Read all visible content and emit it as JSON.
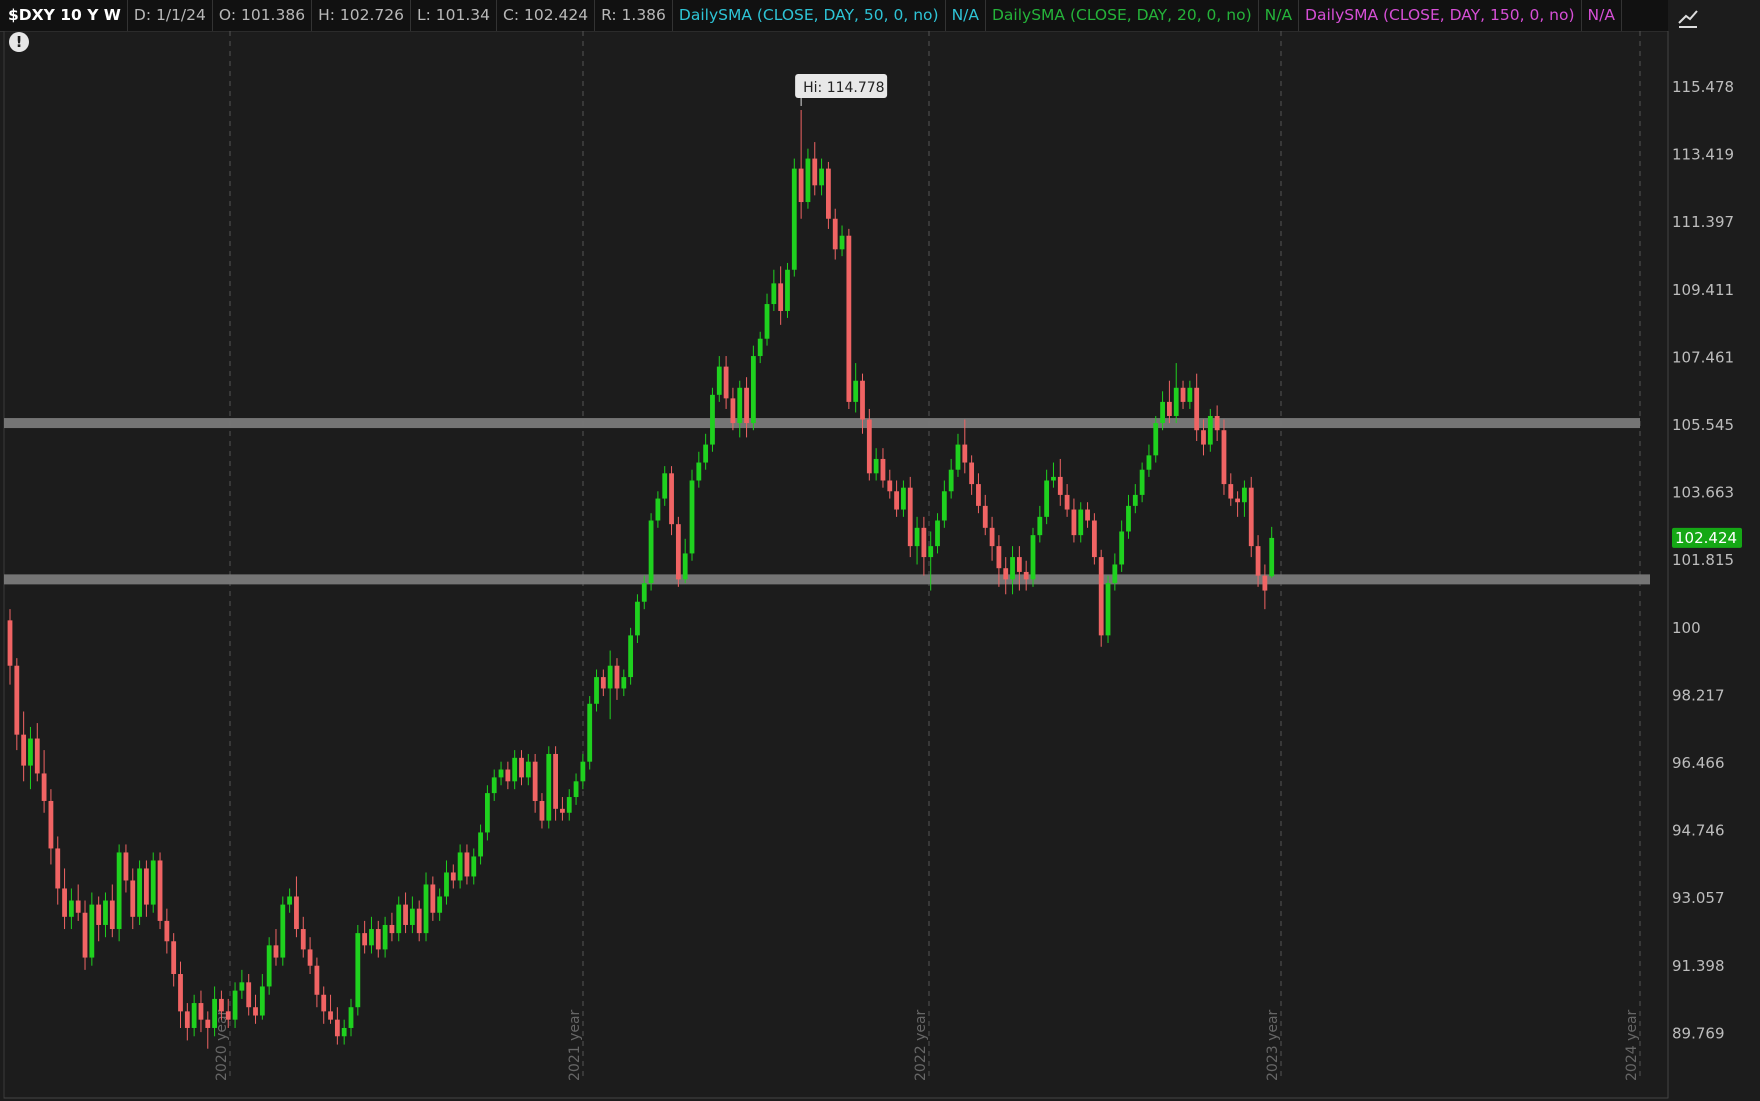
{
  "header": {
    "symbol": "$DXY 10 Y W",
    "date": "D: 1/1/24",
    "open": "O: 101.386",
    "high": "H: 102.726",
    "low": "L: 101.34",
    "close": "C: 102.424",
    "range": "R: 1.386",
    "studies": [
      {
        "label": "DailySMA (CLOSE, DAY, 50, 0, no)",
        "value": "N/A",
        "color": "#2ec4d6"
      },
      {
        "label": "DailySMA (CLOSE, DAY, 20, 0, no)",
        "value": "N/A",
        "color": "#25b33a"
      },
      {
        "label": "DailySMA (CLOSE, DAY, 150, 0, no)",
        "value": "N/A",
        "color": "#d64fd6"
      }
    ]
  },
  "colors": {
    "up": "#1fd11f",
    "down": "#f06464",
    "background": "#1c1c1c",
    "grid": "#555555",
    "level": "#7a7a7a",
    "last_price": "#15a815"
  },
  "icons": {
    "alert": "!",
    "drawing": "drawing-tools-icon"
  },
  "chart_data": {
    "type": "candlestick",
    "y_ticks": [
      "115.478",
      "113.419",
      "111.397",
      "109.411",
      "107.461",
      "105.545",
      "103.663",
      "101.815",
      "100",
      "98.217",
      "96.466",
      "94.746",
      "93.057",
      "91.398",
      "89.769"
    ],
    "x_labels": [
      "2020 year",
      "2021 year",
      "2022 year",
      "2023 year",
      "2024 year"
    ],
    "high_label": "Hi: 114.778",
    "high_value": 114.778,
    "last_price": "102.424",
    "last_value": 102.424,
    "levels": [
      105.6,
      101.3
    ],
    "bars": [
      [
        0,
        100.2,
        99.0,
        100.5,
        98.5
      ],
      [
        1,
        99.0,
        97.2,
        99.2,
        96.8
      ],
      [
        2,
        97.2,
        96.4,
        97.8,
        96.0
      ],
      [
        3,
        96.4,
        97.1,
        97.4,
        95.8
      ],
      [
        4,
        97.1,
        96.2,
        97.5,
        96.0
      ],
      [
        5,
        96.2,
        95.5,
        96.8,
        95.2
      ],
      [
        6,
        95.5,
        94.3,
        95.8,
        93.9
      ],
      [
        7,
        94.3,
        93.3,
        94.6,
        92.9
      ],
      [
        8,
        93.3,
        92.6,
        93.8,
        92.3
      ],
      [
        9,
        92.6,
        93.0,
        93.3,
        92.3
      ],
      [
        10,
        93.0,
        92.7,
        93.4,
        92.5
      ],
      [
        11,
        92.7,
        91.6,
        93.0,
        91.3
      ],
      [
        12,
        91.6,
        92.9,
        93.2,
        91.4
      ],
      [
        13,
        92.9,
        92.4,
        93.1,
        92.0
      ],
      [
        14,
        92.4,
        93.0,
        93.2,
        92.1
      ],
      [
        15,
        93.0,
        92.3,
        93.4,
        92.1
      ],
      [
        16,
        92.3,
        94.2,
        94.4,
        92.0
      ],
      [
        17,
        94.2,
        93.5,
        94.4,
        93.2
      ],
      [
        18,
        93.5,
        92.6,
        93.8,
        92.3
      ],
      [
        19,
        92.6,
        93.8,
        94.0,
        92.4
      ],
      [
        20,
        93.8,
        92.9,
        94.0,
        92.6
      ],
      [
        21,
        92.9,
        94.0,
        94.2,
        92.7
      ],
      [
        22,
        94.0,
        92.5,
        94.2,
        92.3
      ],
      [
        23,
        92.5,
        92.0,
        92.8,
        91.7
      ],
      [
        24,
        92.0,
        91.2,
        92.2,
        90.9
      ],
      [
        25,
        91.2,
        90.3,
        91.5,
        89.9
      ],
      [
        26,
        90.3,
        89.9,
        90.5,
        89.6
      ],
      [
        27,
        89.9,
        90.5,
        90.7,
        89.7
      ],
      [
        28,
        90.5,
        90.1,
        90.8,
        89.8
      ],
      [
        29,
        90.1,
        89.9,
        90.3,
        89.4
      ],
      [
        30,
        89.9,
        90.6,
        90.9,
        89.7
      ],
      [
        31,
        90.6,
        90.3,
        90.8,
        90.1
      ],
      [
        32,
        90.3,
        90.1,
        90.6,
        89.9
      ],
      [
        33,
        90.1,
        90.8,
        91.0,
        89.9
      ],
      [
        34,
        90.8,
        91.0,
        91.3,
        90.6
      ],
      [
        35,
        91.0,
        90.4,
        91.2,
        90.2
      ],
      [
        36,
        90.4,
        90.2,
        90.7,
        90.0
      ],
      [
        37,
        90.2,
        90.9,
        91.2,
        90.1
      ],
      [
        38,
        90.9,
        91.9,
        92.1,
        90.7
      ],
      [
        39,
        91.9,
        91.6,
        92.3,
        91.4
      ],
      [
        40,
        91.6,
        92.9,
        93.1,
        91.4
      ],
      [
        41,
        92.9,
        93.1,
        93.3,
        92.7
      ],
      [
        42,
        93.1,
        92.3,
        93.6,
        92.1
      ],
      [
        43,
        92.3,
        91.8,
        92.6,
        91.6
      ],
      [
        44,
        91.8,
        91.4,
        92.1,
        91.2
      ],
      [
        45,
        91.4,
        90.7,
        91.6,
        90.4
      ],
      [
        46,
        90.7,
        90.3,
        90.9,
        90.0
      ],
      [
        47,
        90.3,
        90.1,
        90.7,
        90.0
      ],
      [
        48,
        90.1,
        89.7,
        90.4,
        89.5
      ],
      [
        49,
        89.7,
        89.9,
        90.1,
        89.5
      ],
      [
        50,
        89.9,
        90.4,
        90.6,
        89.7
      ],
      [
        51,
        90.4,
        92.2,
        92.4,
        90.2
      ],
      [
        52,
        92.2,
        91.9,
        92.5,
        91.7
      ],
      [
        53,
        91.9,
        92.3,
        92.6,
        91.7
      ],
      [
        54,
        92.3,
        91.8,
        92.5,
        91.6
      ],
      [
        55,
        91.8,
        92.4,
        92.6,
        91.6
      ],
      [
        56,
        92.4,
        92.2,
        92.7,
        92.0
      ],
      [
        57,
        92.2,
        92.9,
        93.1,
        92.0
      ],
      [
        58,
        92.9,
        92.4,
        93.2,
        92.2
      ],
      [
        59,
        92.4,
        92.8,
        93.1,
        92.2
      ],
      [
        60,
        92.8,
        92.2,
        93.0,
        92.0
      ],
      [
        61,
        92.2,
        93.4,
        93.7,
        92.0
      ],
      [
        62,
        93.4,
        92.7,
        93.6,
        92.5
      ],
      [
        63,
        92.7,
        93.1,
        93.3,
        92.5
      ],
      [
        64,
        93.1,
        93.7,
        94.0,
        92.9
      ],
      [
        65,
        93.7,
        93.5,
        93.9,
        93.3
      ],
      [
        66,
        93.5,
        94.2,
        94.4,
        93.3
      ],
      [
        67,
        94.2,
        93.6,
        94.4,
        93.4
      ],
      [
        68,
        93.6,
        94.1,
        94.3,
        93.4
      ],
      [
        69,
        94.1,
        94.7,
        94.9,
        93.9
      ],
      [
        70,
        94.7,
        95.7,
        95.9,
        94.5
      ],
      [
        71,
        95.7,
        96.1,
        96.3,
        95.5
      ],
      [
        72,
        96.1,
        96.3,
        96.5,
        95.9
      ],
      [
        73,
        96.3,
        96.0,
        96.5,
        95.8
      ],
      [
        74,
        96.0,
        96.6,
        96.8,
        95.8
      ],
      [
        75,
        96.6,
        96.1,
        96.8,
        95.9
      ],
      [
        76,
        96.1,
        96.5,
        96.7,
        95.9
      ],
      [
        77,
        96.5,
        95.5,
        96.7,
        95.2
      ],
      [
        78,
        95.5,
        95.0,
        95.7,
        94.8
      ],
      [
        79,
        95.0,
        96.7,
        96.9,
        94.8
      ],
      [
        80,
        96.7,
        95.3,
        96.9,
        95.0
      ],
      [
        81,
        95.3,
        95.2,
        95.6,
        95.0
      ],
      [
        82,
        95.2,
        95.6,
        95.8,
        95.0
      ],
      [
        83,
        95.6,
        96.0,
        96.2,
        95.4
      ],
      [
        84,
        96.0,
        96.5,
        96.7,
        95.8
      ],
      [
        85,
        96.5,
        98.0,
        98.2,
        96.3
      ],
      [
        86,
        98.0,
        98.7,
        98.9,
        97.8
      ],
      [
        87,
        98.7,
        98.4,
        98.9,
        98.2
      ],
      [
        88,
        98.4,
        99.0,
        99.4,
        97.6
      ],
      [
        89,
        99.0,
        98.4,
        99.2,
        98.1
      ],
      [
        90,
        98.4,
        98.7,
        98.9,
        98.2
      ],
      [
        91,
        98.7,
        99.8,
        100.0,
        98.5
      ],
      [
        92,
        99.8,
        100.7,
        100.9,
        99.6
      ],
      [
        93,
        100.7,
        101.2,
        101.4,
        100.5
      ],
      [
        94,
        101.2,
        102.9,
        103.1,
        101.0
      ],
      [
        95,
        102.9,
        103.5,
        103.7,
        102.7
      ],
      [
        96,
        103.5,
        104.2,
        104.4,
        103.3
      ],
      [
        97,
        104.2,
        102.8,
        104.4,
        102.5
      ],
      [
        98,
        102.8,
        101.3,
        103.0,
        101.1
      ],
      [
        99,
        101.3,
        102.0,
        102.4,
        101.2
      ],
      [
        100,
        102.0,
        104.0,
        104.3,
        101.8
      ],
      [
        101,
        104.0,
        104.5,
        104.8,
        103.8
      ],
      [
        102,
        104.5,
        105.0,
        105.3,
        104.3
      ],
      [
        103,
        105.0,
        106.4,
        106.6,
        104.8
      ],
      [
        104,
        106.4,
        107.2,
        107.5,
        106.2
      ],
      [
        105,
        107.2,
        106.3,
        107.5,
        106.0
      ],
      [
        106,
        106.3,
        105.6,
        106.6,
        105.4
      ],
      [
        107,
        105.6,
        106.6,
        106.8,
        105.2
      ],
      [
        108,
        106.6,
        105.6,
        106.9,
        105.2
      ],
      [
        109,
        105.6,
        107.5,
        107.8,
        105.4
      ],
      [
        110,
        107.5,
        108.0,
        108.2,
        107.3
      ],
      [
        111,
        108.0,
        109.0,
        109.3,
        107.8
      ],
      [
        112,
        109.0,
        109.6,
        110.0,
        108.8
      ],
      [
        113,
        109.6,
        108.8,
        110.1,
        108.4
      ],
      [
        114,
        108.8,
        110.0,
        110.2,
        108.6
      ],
      [
        115,
        110.0,
        113.0,
        113.3,
        109.8
      ],
      [
        116,
        113.0,
        112.0,
        114.778,
        111.5
      ],
      [
        117,
        112.0,
        113.3,
        113.6,
        111.8
      ],
      [
        118,
        113.3,
        112.5,
        113.8,
        112.2
      ],
      [
        119,
        112.5,
        113.0,
        113.3,
        112.2
      ],
      [
        120,
        113.0,
        111.5,
        113.2,
        111.2
      ],
      [
        121,
        111.5,
        110.6,
        111.8,
        110.3
      ],
      [
        122,
        110.6,
        111.0,
        111.3,
        110.4
      ],
      [
        123,
        111.0,
        106.2,
        111.2,
        106.0
      ],
      [
        124,
        106.2,
        106.8,
        107.3,
        105.9
      ],
      [
        125,
        106.8,
        105.7,
        107.0,
        105.3
      ],
      [
        126,
        105.7,
        104.2,
        106.0,
        104.0
      ],
      [
        127,
        104.2,
        104.6,
        104.9,
        104.0
      ],
      [
        128,
        104.6,
        104.0,
        104.9,
        103.8
      ],
      [
        129,
        104.0,
        103.7,
        104.3,
        103.5
      ],
      [
        130,
        103.7,
        103.2,
        104.0,
        103.0
      ],
      [
        131,
        103.2,
        103.8,
        104.0,
        103.0
      ],
      [
        132,
        103.8,
        102.2,
        104.1,
        101.9
      ],
      [
        133,
        102.2,
        102.7,
        103.0,
        101.7
      ],
      [
        134,
        102.7,
        101.9,
        103.0,
        101.4
      ],
      [
        135,
        101.9,
        102.2,
        102.6,
        101.0
      ],
      [
        136,
        102.2,
        102.9,
        103.1,
        102.0
      ],
      [
        137,
        102.9,
        103.7,
        104.0,
        102.7
      ],
      [
        138,
        103.7,
        104.3,
        104.6,
        103.5
      ],
      [
        139,
        104.3,
        105.0,
        105.3,
        104.1
      ],
      [
        140,
        105.0,
        104.5,
        105.7,
        104.2
      ],
      [
        141,
        104.5,
        103.9,
        104.7,
        103.6
      ],
      [
        142,
        103.9,
        103.3,
        104.2,
        103.1
      ],
      [
        143,
        103.3,
        102.7,
        103.6,
        102.5
      ],
      [
        144,
        102.7,
        102.2,
        103.0,
        101.8
      ],
      [
        145,
        102.2,
        101.6,
        102.5,
        101.1
      ],
      [
        146,
        101.6,
        101.3,
        101.9,
        100.9
      ],
      [
        147,
        101.3,
        101.9,
        102.2,
        100.9
      ],
      [
        148,
        101.9,
        101.5,
        102.2,
        101.0
      ],
      [
        149,
        101.5,
        101.3,
        101.8,
        101.0
      ],
      [
        150,
        101.3,
        102.5,
        102.7,
        101.1
      ],
      [
        151,
        102.5,
        103.0,
        103.3,
        102.3
      ],
      [
        152,
        103.0,
        104.0,
        104.3,
        102.8
      ],
      [
        153,
        104.0,
        104.1,
        104.5,
        103.8
      ],
      [
        154,
        104.1,
        103.6,
        104.6,
        103.3
      ],
      [
        155,
        103.6,
        103.2,
        103.9,
        103.0
      ],
      [
        156,
        103.2,
        102.5,
        103.5,
        102.3
      ],
      [
        157,
        102.5,
        103.2,
        103.4,
        102.3
      ],
      [
        158,
        103.2,
        102.9,
        103.4,
        102.7
      ],
      [
        159,
        102.9,
        101.9,
        103.1,
        101.7
      ],
      [
        160,
        101.9,
        99.8,
        102.1,
        99.5
      ],
      [
        161,
        99.8,
        101.2,
        101.4,
        99.6
      ],
      [
        162,
        101.2,
        101.7,
        102.0,
        101.0
      ],
      [
        163,
        101.7,
        102.6,
        102.9,
        101.5
      ],
      [
        164,
        102.6,
        103.3,
        103.6,
        102.4
      ],
      [
        165,
        103.3,
        103.6,
        103.9,
        103.1
      ],
      [
        166,
        103.6,
        104.3,
        104.5,
        103.4
      ],
      [
        167,
        104.3,
        104.7,
        105.0,
        104.1
      ],
      [
        168,
        104.7,
        105.6,
        105.8,
        104.5
      ],
      [
        169,
        105.6,
        106.2,
        106.5,
        105.4
      ],
      [
        170,
        106.2,
        105.8,
        106.8,
        105.6
      ],
      [
        171,
        105.8,
        106.6,
        107.3,
        105.6
      ],
      [
        172,
        106.6,
        106.2,
        106.8,
        106.0
      ],
      [
        173,
        106.2,
        106.6,
        106.8,
        106.0
      ],
      [
        174,
        106.6,
        105.4,
        107.0,
        105.1
      ],
      [
        175,
        105.4,
        105.0,
        105.7,
        104.7
      ],
      [
        176,
        105.0,
        105.8,
        106.0,
        104.8
      ],
      [
        177,
        105.8,
        105.4,
        106.1,
        105.1
      ],
      [
        178,
        105.4,
        103.9,
        105.7,
        103.6
      ],
      [
        179,
        103.9,
        103.5,
        104.2,
        103.3
      ],
      [
        180,
        103.5,
        103.4,
        103.7,
        103.0
      ],
      [
        181,
        103.4,
        103.8,
        104.0,
        103.0
      ],
      [
        182,
        103.8,
        102.2,
        104.1,
        101.9
      ],
      [
        183,
        102.2,
        101.4,
        102.5,
        101.1
      ],
      [
        184,
        101.4,
        101.0,
        101.7,
        100.5
      ],
      [
        185,
        101.386,
        102.424,
        102.726,
        101.34
      ]
    ]
  }
}
